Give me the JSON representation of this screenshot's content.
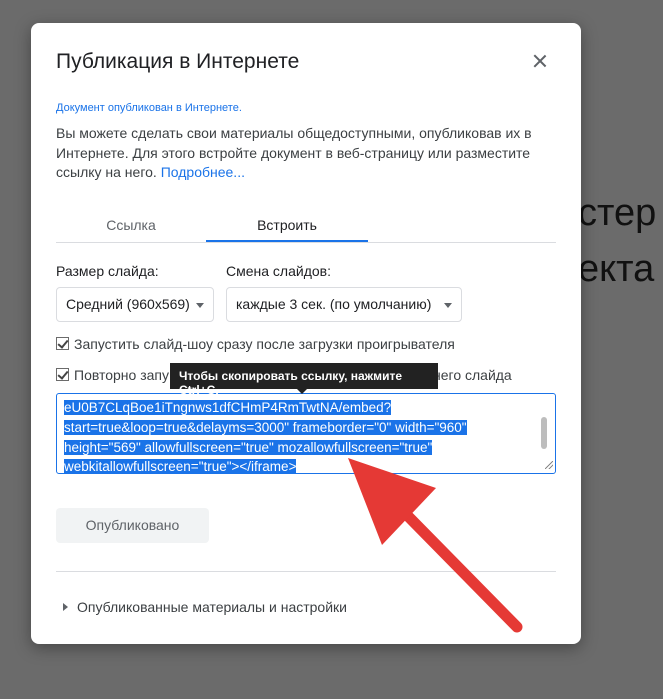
{
  "background": {
    "text_line1": "стер",
    "text_line2": "екта"
  },
  "dialog": {
    "title": "Публикация в Интернете",
    "status": "Документ опубликован в Интернете.",
    "description": "Вы можете сделать свои материалы общедоступными, опубликовав их в Интернете. Для этого встройте документ в веб-страницу или разместите ссылку на него.",
    "more_link": "Подробнее...",
    "tabs": [
      {
        "label": "Ссылка",
        "active": false
      },
      {
        "label": "Встроить",
        "active": true
      }
    ],
    "slide_size": {
      "label": "Размер слайда:",
      "value": "Средний (960x569)"
    },
    "slide_change": {
      "label": "Смена слайдов:",
      "value": "каждые 3 сек. (по умолчанию)"
    },
    "checkbox_autostart": {
      "label": "Запустить слайд-шоу сразу после загрузки проигрывателя",
      "checked": true
    },
    "checkbox_loop": {
      "label_start": "Повторно запу",
      "label_end": "него слайда",
      "checked": true
    },
    "tooltip": "Чтобы скопировать ссылку, нажмите Ctrl+C.",
    "embed_code_lines": [
      "eU0B7CLqBoe1iTngnws1dfCHmP4RmTwtNA/embed?",
      "start=true&loop=true&delayms=3000\" frameborder=\"0\" width=\"960\"",
      "height=\"569\" allowfullscreen=\"true\" mozallowfullscreen=\"true\"",
      "webkitallowfullscreen=\"true\"></iframe>"
    ],
    "published_button": "Опубликовано",
    "expander": "Опубликованные материалы и настройки"
  },
  "colors": {
    "accent": "#1a73e8",
    "arrow": "#e53935",
    "overlay": "#6b6b6b"
  }
}
